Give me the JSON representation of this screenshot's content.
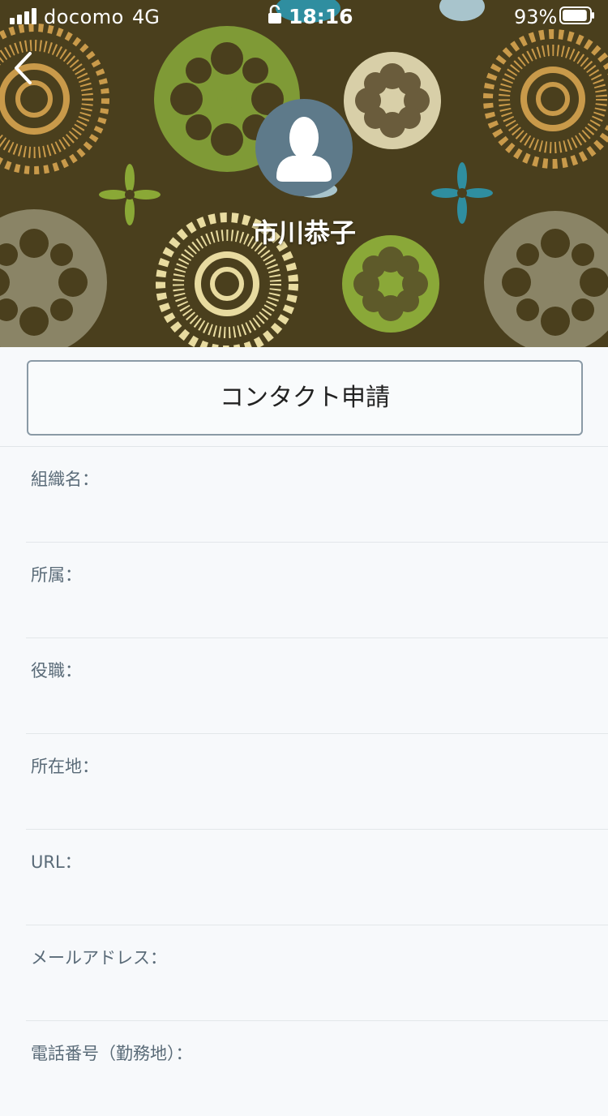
{
  "status_bar": {
    "carrier": "docomo",
    "network": "4G",
    "time": "18:16",
    "battery_percent": "93%",
    "battery_level": 0.93,
    "signal_bars": 4
  },
  "header": {
    "back_icon": "chevron-left-icon",
    "avatar_icon": "person-silhouette-icon",
    "name": "市川恭子"
  },
  "actions": {
    "contact_request_label": "コンタクト申請"
  },
  "fields": [
    {
      "label": "組織名：",
      "value": ""
    },
    {
      "label": "所属：",
      "value": ""
    },
    {
      "label": "役職：",
      "value": ""
    },
    {
      "label": "所在地：",
      "value": ""
    },
    {
      "label": "URL：",
      "value": ""
    },
    {
      "label": "メールアドレス：",
      "value": ""
    },
    {
      "label": "電話番号（勤務地）：",
      "value": ""
    }
  ],
  "colors": {
    "header_bg": "#4a3f1d",
    "avatar_bg": "#5e7a8a",
    "page_bg": "#f7f9fb",
    "label_text": "#5a6b78"
  }
}
